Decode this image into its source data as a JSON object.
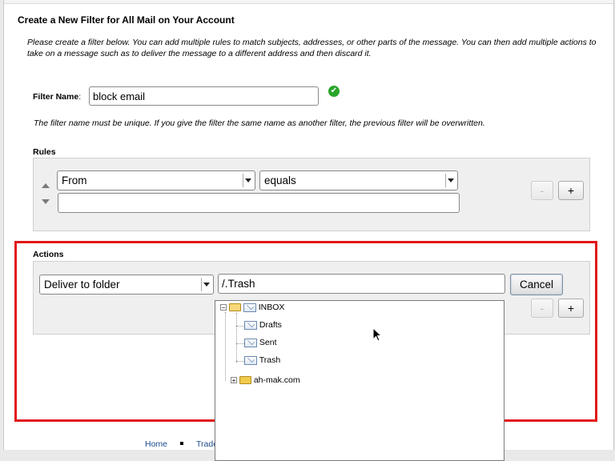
{
  "page": {
    "title": "Create a New Filter for All Mail on Your Account",
    "intro": "Please create a filter below. You can add multiple rules to match subjects, addresses, or other parts of the message. You can then add multiple actions to take on a message such as to deliver the message to a different address and then discard it."
  },
  "filter_name": {
    "label": "Filter Name",
    "label_suffix": ":",
    "value": "block email",
    "valid_icon": "check-circle-icon",
    "note": "The filter name must be unique. If you give the filter the same name as another filter, the previous filter will be overwritten."
  },
  "rules": {
    "label": "Rules",
    "field_select": "From",
    "operator_select": "equals",
    "value_input": "",
    "remove_label": "-",
    "add_label": "+"
  },
  "actions": {
    "label": "Actions",
    "action_select": "Deliver to folder",
    "folder_input": "/.Trash",
    "cancel_label": "Cancel",
    "remove_label": "-",
    "add_label": "+"
  },
  "folder_tree": {
    "root": {
      "label": "INBOX",
      "toggle": "−"
    },
    "children": [
      {
        "label": "Drafts"
      },
      {
        "label": "Sent"
      },
      {
        "label": "Trash"
      }
    ],
    "account": {
      "label": "ah-mak.com",
      "toggle": "+"
    }
  },
  "footer": {
    "links": [
      "Home",
      "Trader"
    ]
  },
  "colors": {
    "highlight_frame": "#e21616",
    "valid_green": "#2aa52a",
    "link_blue": "#1a4a8a"
  }
}
